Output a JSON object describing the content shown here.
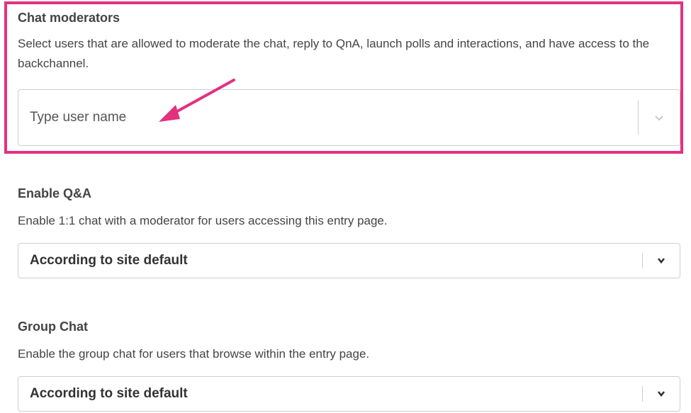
{
  "chat_moderators": {
    "title": "Chat moderators",
    "description": "Select users that are allowed to moderate the chat, reply to QnA, launch polls and interactions, and have access to the backchannel.",
    "input_placeholder": "Type user name"
  },
  "enable_qa": {
    "title": "Enable Q&A",
    "description": "Enable 1:1 chat with a moderator for users accessing this entry page.",
    "selected_value": "According to site default"
  },
  "group_chat": {
    "title": "Group Chat",
    "description": "Enable the group chat for users that browse within the entry page.",
    "selected_value": "According to site default"
  },
  "colors": {
    "highlight": "#e4317f",
    "annotation_arrow": "#e4317f",
    "border": "#cfcfcf"
  },
  "icons": [
    "chevron-down-icon",
    "annotation-arrow"
  ]
}
